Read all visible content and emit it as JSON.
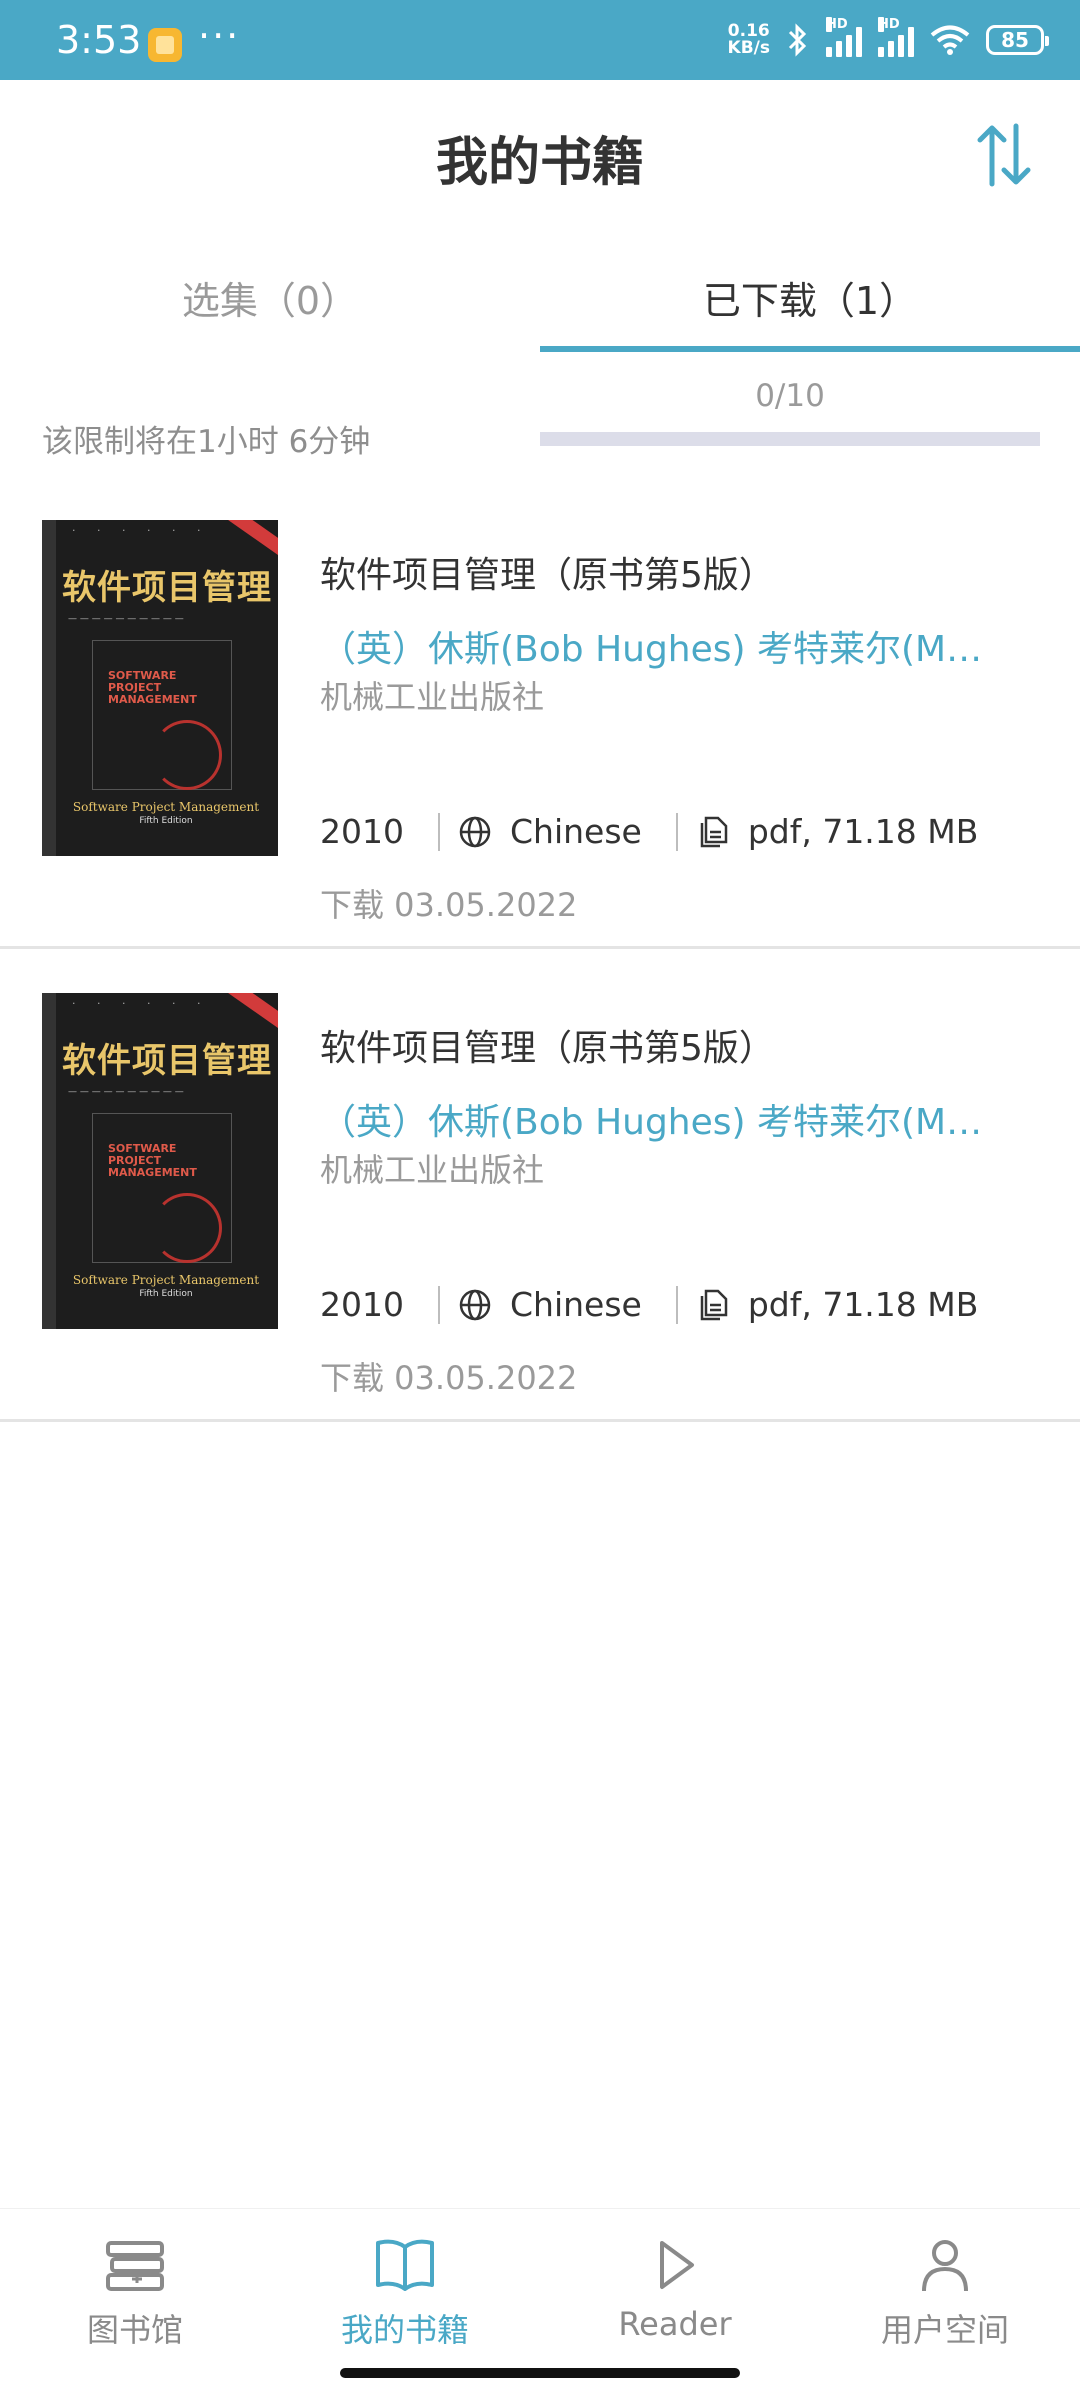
{
  "status_bar": {
    "time": "3:53",
    "more": "···",
    "net_speed_value": "0.16",
    "net_speed_unit": "KB/s",
    "signal_label": "HD",
    "battery": "85"
  },
  "header": {
    "title": "我的书籍"
  },
  "tabs": [
    {
      "label": "选集（0）",
      "active": false
    },
    {
      "label": "已下载（1）",
      "active": true
    }
  ],
  "limit": {
    "text": "该限制将在1小时 6分钟",
    "count_text": "0/10",
    "used": 0,
    "max": 10
  },
  "books": [
    {
      "title": "软件项目管理（原书第5版）",
      "author": "（英）休斯(Bob Hughes) 考特莱尔(Mi…",
      "publisher": "机械工业出版社",
      "year": "2010",
      "language": "Chinese",
      "file_info": "pdf, 71.18 MB",
      "download_date": "下载 03.05.2022",
      "cover": {
        "title": "软件项目管理",
        "en_title": "SOFTWARE PROJECT MANAGEMENT",
        "subtitle": "Software Project Management",
        "edition": "Fifth Edition"
      }
    },
    {
      "title": "软件项目管理（原书第5版）",
      "author": "（英）休斯(Bob Hughes) 考特莱尔(Mi…",
      "publisher": "机械工业出版社",
      "year": "2010",
      "language": "Chinese",
      "file_info": "pdf, 71.18 MB",
      "download_date": "下载 03.05.2022",
      "cover": {
        "title": "软件项目管理",
        "en_title": "SOFTWARE PROJECT MANAGEMENT",
        "subtitle": "Software Project Management",
        "edition": "Fifth Edition"
      }
    }
  ],
  "bottom_nav": [
    {
      "label": "图书馆",
      "icon": "library-icon",
      "active": false
    },
    {
      "label": "我的书籍",
      "icon": "open-book-icon",
      "active": true
    },
    {
      "label": "Reader",
      "icon": "play-icon",
      "active": false
    },
    {
      "label": "用户空间",
      "icon": "user-icon",
      "active": false
    }
  ],
  "colors": {
    "accent": "#4aa8c6",
    "text_primary": "#333333",
    "text_secondary": "#9a9a9a",
    "progress_track": "#dcdde9"
  }
}
